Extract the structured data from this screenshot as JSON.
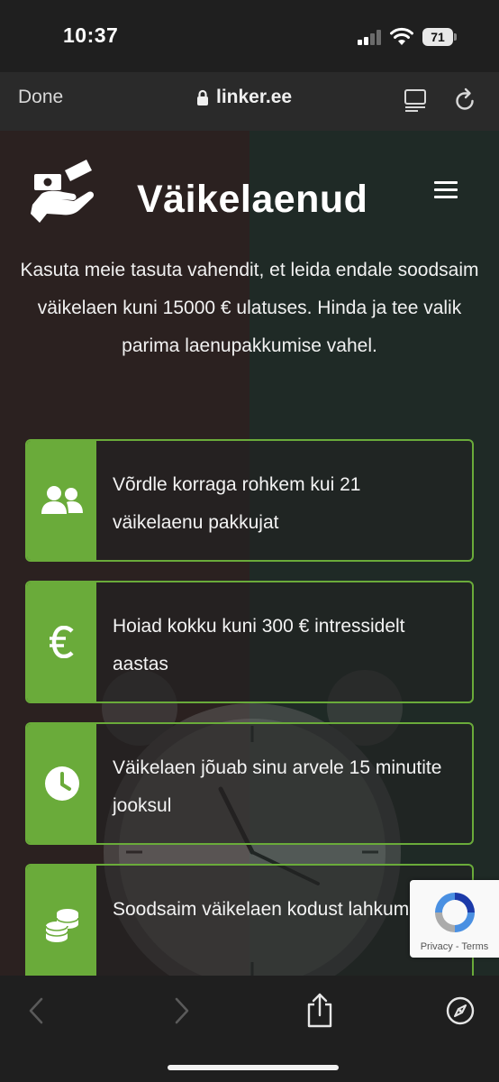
{
  "status_bar": {
    "time": "10:37",
    "battery_level": "71",
    "signal_bars": 2,
    "icons": [
      "cellular-signal-icon",
      "wifi-icon",
      "battery-icon"
    ]
  },
  "browser": {
    "done_label": "Done",
    "url": "linker.ee",
    "icons": [
      "lock-icon",
      "reader-view-icon",
      "reload-icon"
    ]
  },
  "header": {
    "brand": "Väikelaenud",
    "logo_icon": "hand-money-icon",
    "menu_icon": "hamburger-menu-icon"
  },
  "intro_text": "Kasuta meie tasuta vahendit, et leida endale soodsaim väikelaen kuni 15000 € ulatuses. Hinda ja tee valik parima laenupakkumise vahel.",
  "features": [
    {
      "icon": "users-icon",
      "text": "Võrdle korraga rohkem kui 21 väikelaenu pakkujat"
    },
    {
      "icon": "euro-icon",
      "text": "Hoiad kokku kuni 300 € intressidelt aastas"
    },
    {
      "icon": "clock-icon",
      "text": "Väikelaen jõuab sinu arvele 15 minutite jooksul"
    },
    {
      "icon": "coins-icon",
      "text": "Soodsaim väikelaen kodust lahkumata"
    }
  ],
  "recaptcha": {
    "privacy": "Privacy",
    "separator": " - ",
    "terms": "Terms"
  },
  "toolbar": {
    "icons": [
      "back-icon",
      "forward-icon",
      "share-icon",
      "compass-icon"
    ]
  },
  "colors": {
    "accent_green": "#6aab3a",
    "status_bar_bg": "#1f1f1f",
    "nav_bar_bg": "#2a2a2a"
  }
}
